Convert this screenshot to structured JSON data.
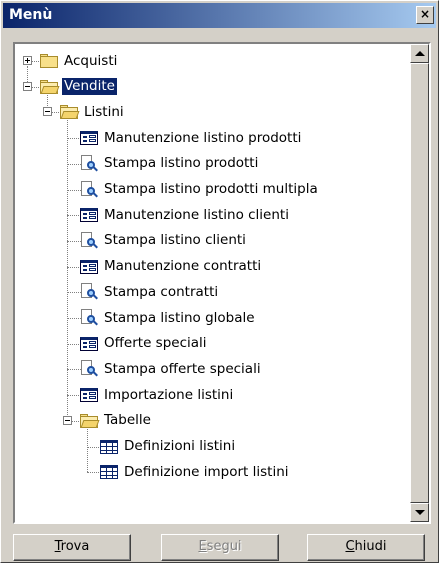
{
  "window": {
    "title": "Menù",
    "close_glyph": "×"
  },
  "tree": [
    {
      "label": "Acquisti",
      "icon": "folder-icon",
      "level": 0,
      "expander": "plus",
      "selected": false
    },
    {
      "label": "Vendite",
      "icon": "folder-open-icon",
      "level": 0,
      "expander": "minus",
      "selected": true
    },
    {
      "label": "Listini",
      "icon": "folder-open-icon",
      "level": 1,
      "expander": "minus",
      "selected": false
    },
    {
      "label": "Manutenzione listino prodotti",
      "icon": "form-icon",
      "level": 2,
      "expander": null,
      "selected": false
    },
    {
      "label": "Stampa listino prodotti",
      "icon": "print-icon",
      "level": 2,
      "expander": null,
      "selected": false
    },
    {
      "label": "Stampa listino prodotti multipla",
      "icon": "print-icon",
      "level": 2,
      "expander": null,
      "selected": false
    },
    {
      "label": "Manutenzione listino clienti",
      "icon": "form-icon",
      "level": 2,
      "expander": null,
      "selected": false
    },
    {
      "label": "Stampa listino clienti",
      "icon": "print-icon",
      "level": 2,
      "expander": null,
      "selected": false
    },
    {
      "label": "Manutenzione contratti",
      "icon": "form-icon",
      "level": 2,
      "expander": null,
      "selected": false
    },
    {
      "label": "Stampa contratti",
      "icon": "print-icon",
      "level": 2,
      "expander": null,
      "selected": false
    },
    {
      "label": "Stampa listino globale",
      "icon": "print-icon",
      "level": 2,
      "expander": null,
      "selected": false
    },
    {
      "label": "Offerte speciali",
      "icon": "form-icon",
      "level": 2,
      "expander": null,
      "selected": false
    },
    {
      "label": "Stampa offerte speciali",
      "icon": "print-icon",
      "level": 2,
      "expander": null,
      "selected": false
    },
    {
      "label": "Importazione listini",
      "icon": "form-icon",
      "level": 2,
      "expander": null,
      "selected": false
    },
    {
      "label": "Tabelle",
      "icon": "folder-open-icon",
      "level": 2,
      "expander": "minus",
      "selected": false
    },
    {
      "label": "Definizioni listini",
      "icon": "table-icon",
      "level": 3,
      "expander": null,
      "selected": false
    },
    {
      "label": "Definizione import listini",
      "icon": "table-icon",
      "level": 3,
      "expander": null,
      "selected": false
    }
  ],
  "buttons": {
    "trova": {
      "access": "T",
      "rest": "rova",
      "enabled": true
    },
    "esegui": {
      "access": "E",
      "rest": "segui",
      "enabled": false
    },
    "chiudi": {
      "access": "C",
      "rest": "hiudi",
      "enabled": true
    }
  }
}
